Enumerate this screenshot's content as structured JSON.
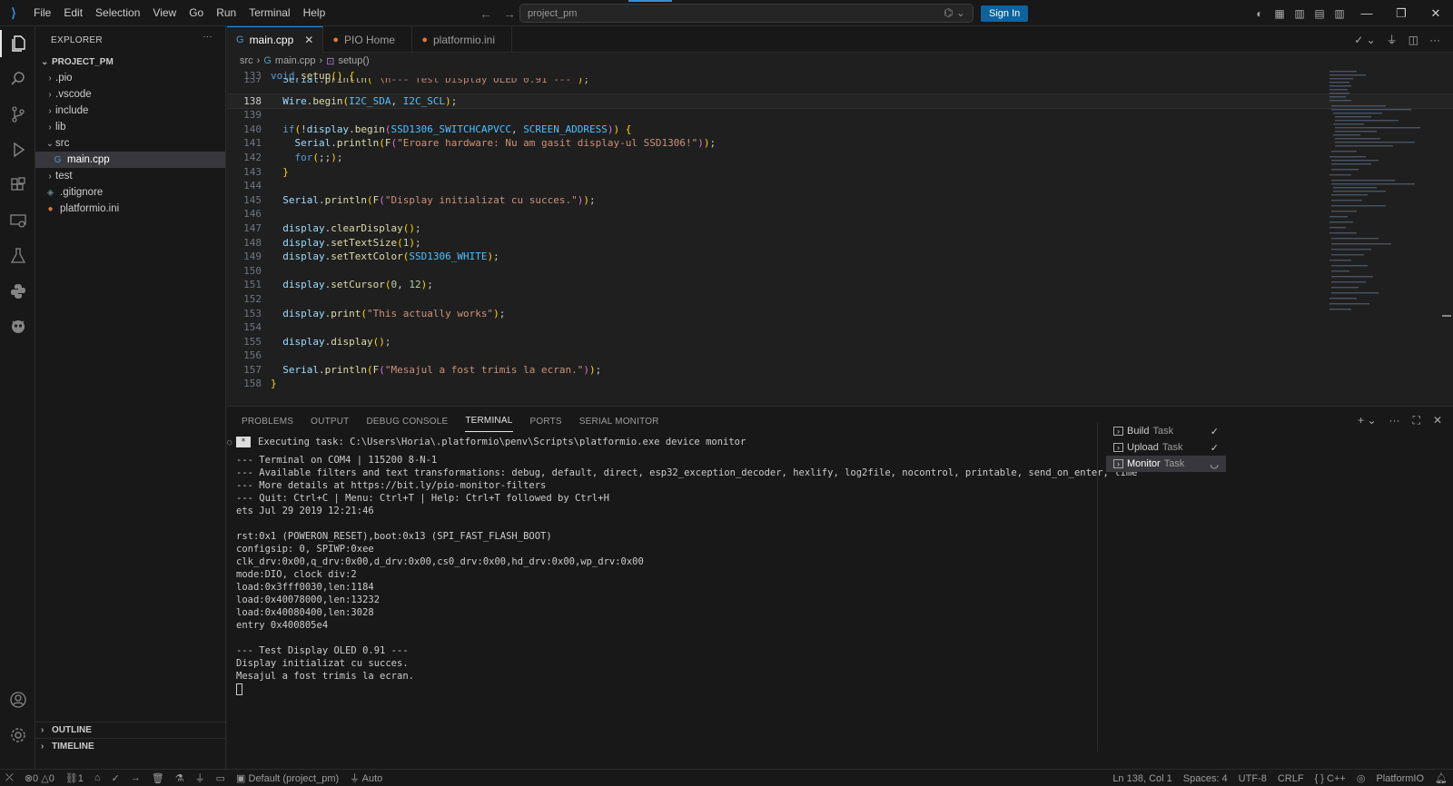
{
  "titlebar": {
    "menu": [
      "File",
      "Edit",
      "Selection",
      "View",
      "Go",
      "Run",
      "Terminal",
      "Help"
    ],
    "search_value": "project_pm",
    "signin_label": "Sign In"
  },
  "explorer": {
    "header": "EXPLORER",
    "root": "PROJECT_PM",
    "items": [
      {
        "label": ".pio",
        "type": "folder"
      },
      {
        "label": ".vscode",
        "type": "folder"
      },
      {
        "label": "include",
        "type": "folder"
      },
      {
        "label": "lib",
        "type": "folder"
      },
      {
        "label": "src",
        "type": "folder-open"
      },
      {
        "label": "main.cpp",
        "type": "file"
      },
      {
        "label": "test",
        "type": "folder"
      },
      {
        "label": ".gitignore",
        "type": "file"
      },
      {
        "label": "platformio.ini",
        "type": "file"
      }
    ],
    "outline": "OUTLINE",
    "timeline": "TIMELINE"
  },
  "tabs": [
    {
      "label": "main.cpp",
      "active": true
    },
    {
      "label": "PIO Home",
      "active": false
    },
    {
      "label": "platformio.ini",
      "active": false
    }
  ],
  "breadcrumb": {
    "folder": "src",
    "file": "main.cpp",
    "symbol": "setup()"
  },
  "code": {
    "line_numbers": [
      "133",
      "137",
      "138",
      "139",
      "140",
      "141",
      "142",
      "143",
      "144",
      "145",
      "146",
      "147",
      "148",
      "149",
      "150",
      "151",
      "152",
      "153",
      "154",
      "155",
      "156",
      "157",
      "158"
    ],
    "current_line": "138",
    "lines": [
      "void setup() {",
      "  Serial.println(\"\\n--- Test Display OLED 0.91 ---\");",
      "  Wire.begin(I2C_SDA, I2C_SCL);",
      "",
      "  if(!display.begin(SSD1306_SWITCHCAPVCC, SCREEN_ADDRESS)) {",
      "    Serial.println(F(\"Eroare hardware: Nu am gasit display-ul SSD1306!\"));",
      "    for(;;);",
      "  }",
      "",
      "  Serial.println(F(\"Display initializat cu succes.\"));",
      "",
      "  display.clearDisplay();",
      "  display.setTextSize(1);",
      "  display.setTextColor(SSD1306_WHITE);",
      "",
      "  display.setCursor(0, 12);",
      "",
      "  display.print(\"This actually works\");",
      "",
      "  display.display();",
      "",
      "  Serial.println(F(\"Mesajul a fost trimis la ecran.\"));",
      "}"
    ]
  },
  "panel": {
    "tabs": [
      "PROBLEMS",
      "OUTPUT",
      "DEBUG CONSOLE",
      "TERMINAL",
      "PORTS",
      "SERIAL MONITOR"
    ],
    "active_tab": "TERMINAL",
    "terminal_lines": [
      "Executing task: C:\\Users\\Horia\\.platformio\\penv\\Scripts\\platformio.exe device monitor",
      "",
      "--- Terminal on COM4 | 115200 8-N-1",
      "--- Available filters and text transformations: debug, default, direct, esp32_exception_decoder, hexlify, log2file, nocontrol, printable, send_on_enter, time",
      "--- More details at https://bit.ly/pio-monitor-filters",
      "--- Quit: Ctrl+C | Menu: Ctrl+T | Help: Ctrl+T followed by Ctrl+H",
      "ets Jul 29 2019 12:21:46",
      "",
      "rst:0x1 (POWERON_RESET),boot:0x13 (SPI_FAST_FLASH_BOOT)",
      "configsip: 0, SPIWP:0xee",
      "clk_drv:0x00,q_drv:0x00,d_drv:0x00,cs0_drv:0x00,hd_drv:0x00,wp_drv:0x00",
      "mode:DIO, clock div:2",
      "load:0x3fff0030,len:1184",
      "load:0x40078000,len:13232",
      "load:0x40080400,len:3028",
      "entry 0x400805e4",
      "",
      "--- Test Display OLED 0.91 ---",
      "Display initializat cu succes.",
      "Mesajul a fost trimis la ecran."
    ],
    "tasks": [
      {
        "name": "Build",
        "suffix": "Task",
        "status": "✓"
      },
      {
        "name": "Upload",
        "suffix": "Task",
        "status": "✓"
      },
      {
        "name": "Monitor",
        "suffix": "Task",
        "status": "◡"
      }
    ]
  },
  "statusbar": {
    "errors": "0",
    "warnings": "0",
    "ports": "1",
    "env": "Default (project_pm)",
    "auto": "Auto",
    "position": "Ln 138, Col 1",
    "spaces": "Spaces: 4",
    "encoding": "UTF-8",
    "eol": "CRLF",
    "language": "C++",
    "platformio": "PlatformIO"
  }
}
